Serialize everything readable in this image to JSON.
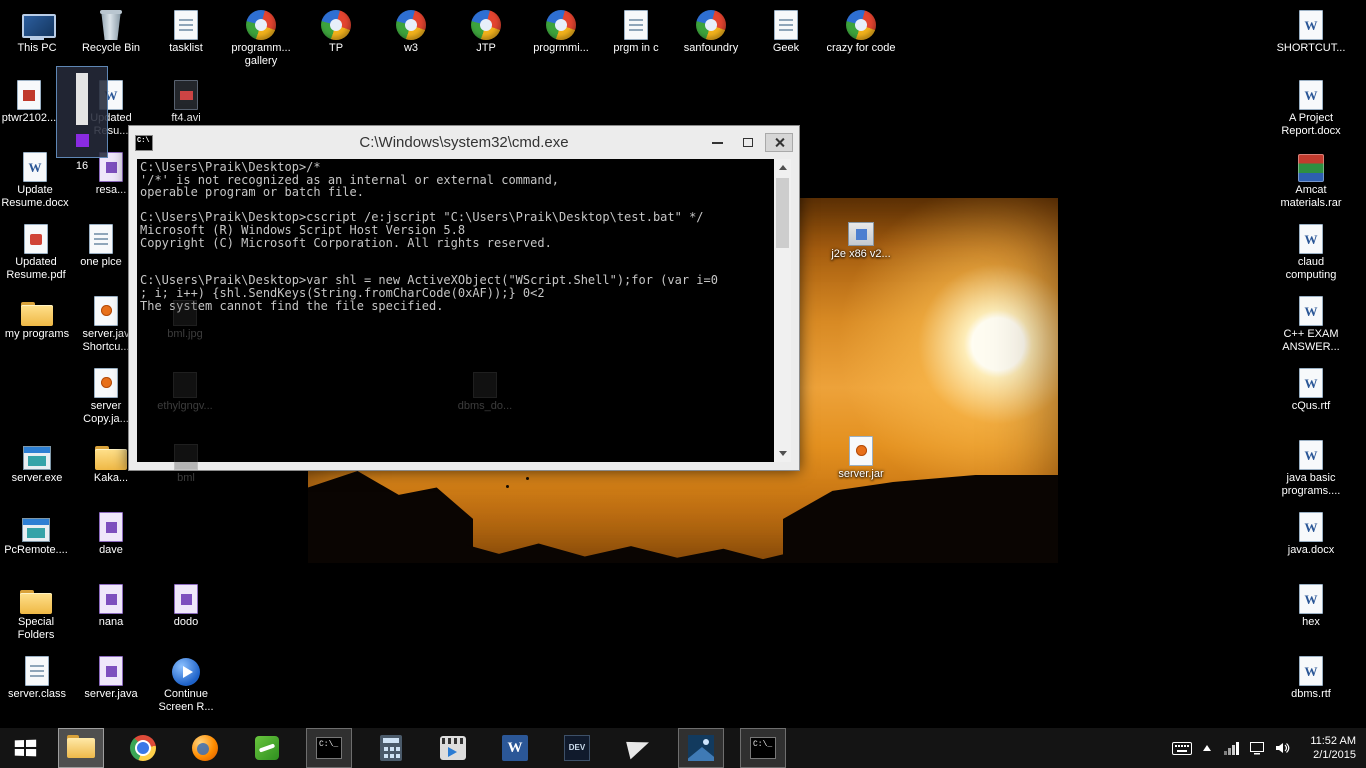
{
  "cmd": {
    "title": "C:\\Windows\\system32\\cmd.exe",
    "lines": [
      "C:\\Users\\Praik\\Desktop>/*",
      "'/*' is not recognized as an internal or external command,",
      "operable program or batch file.",
      "",
      "C:\\Users\\Praik\\Desktop>cscript /e:jscript \"C:\\Users\\Praik\\Desktop\\test.bat\" */",
      "Microsoft (R) Windows Script Host Version 5.8",
      "Copyright (C) Microsoft Corporation. All rights reserved.",
      "",
      "",
      "C:\\Users\\Praik\\Desktop>var shl = new ActiveXObject(\"WScript.Shell\");for (var i=0",
      "; i; i++) {shl.SendKeys(String.fromCharCode(0xAF));} 0<2",
      "The system cannot find the file specified."
    ]
  },
  "desktop": {
    "selected_tile": {
      "label": "16",
      "icon": "slider-icon"
    },
    "icons": [
      {
        "label": "This PC",
        "icon": "computer-icon"
      },
      {
        "label": "Recycle Bin",
        "icon": "recycle-bin-icon"
      },
      {
        "label": "tasklist",
        "icon": "document-icon"
      },
      {
        "label": "programm... gallery",
        "icon": "web-shortcut-icon"
      },
      {
        "label": "TP",
        "icon": "web-shortcut-icon"
      },
      {
        "label": "w3",
        "icon": "web-shortcut-icon"
      },
      {
        "label": "JTP",
        "icon": "web-shortcut-icon"
      },
      {
        "label": "progrmmi...",
        "icon": "web-shortcut-icon"
      },
      {
        "label": "prgm in c",
        "icon": "document-icon"
      },
      {
        "label": "sanfoundry",
        "icon": "web-shortcut-icon"
      },
      {
        "label": "Geek",
        "icon": "document-icon"
      },
      {
        "label": "crazy for code",
        "icon": "web-shortcut-icon"
      },
      {
        "label": "SHORTCUT...",
        "icon": "word-document-icon"
      },
      {
        "label": "ptwr2102...",
        "icon": "red-document-icon"
      },
      {
        "label": "Updated Resu...",
        "icon": "word-document-icon"
      },
      {
        "label": "ft4.avi",
        "icon": "video-file-icon"
      },
      {
        "label": "A Project Report.docx",
        "icon": "word-document-icon"
      },
      {
        "label": "Update Resume.docx",
        "icon": "word-document-icon"
      },
      {
        "label": "resa...",
        "icon": "purple-file-icon"
      },
      {
        "label": "Amcat materials.rar",
        "icon": "rar-archive-icon"
      },
      {
        "label": "Updated Resume.pdf",
        "icon": "pdf-document-icon"
      },
      {
        "label": "one plce",
        "icon": "document-icon"
      },
      {
        "label": "claud computing",
        "icon": "word-document-icon"
      },
      {
        "label": "my programs",
        "icon": "folder-icon"
      },
      {
        "label": "server.jav Shortcu...",
        "icon": "java-file-icon"
      },
      {
        "label": "C++ EXAM ANSWER...",
        "icon": "word-document-icon"
      },
      {
        "label": "server Copy.ja...",
        "icon": "java-file-icon"
      },
      {
        "label": "cQus.rtf",
        "icon": "word-document-icon"
      },
      {
        "label": "server.exe",
        "icon": "application-icon"
      },
      {
        "label": "Kaka...",
        "icon": "folder-icon"
      },
      {
        "label": "java basic programs....",
        "icon": "word-document-icon"
      },
      {
        "label": "PcRemote....",
        "icon": "application-icon"
      },
      {
        "label": "dave",
        "icon": "purple-file-icon"
      },
      {
        "label": "java.docx",
        "icon": "word-document-icon"
      },
      {
        "label": "Special Folders",
        "icon": "folder-icon"
      },
      {
        "label": "nana",
        "icon": "purple-file-icon"
      },
      {
        "label": "dodo",
        "icon": "purple-file-icon"
      },
      {
        "label": "hex",
        "icon": "word-document-icon"
      },
      {
        "label": "server.class",
        "icon": "document-icon"
      },
      {
        "label": "server.java",
        "icon": "purple-file-icon"
      },
      {
        "label": "Continue Screen R...",
        "icon": "blue-app-icon"
      },
      {
        "label": "dbms.rtf",
        "icon": "word-document-icon"
      },
      {
        "label": "j2e x86 v2...",
        "icon": "installer-icon"
      },
      {
        "label": "server.jar",
        "icon": "java-file-icon"
      },
      {
        "label": "bml.jpg",
        "icon": "ghost-file-icon"
      },
      {
        "label": "ethylgngv...",
        "icon": "ghost-file-icon"
      },
      {
        "label": "dbms_do...",
        "icon": "ghost-file-icon"
      },
      {
        "label": "bml",
        "icon": "ghost-file-icon"
      }
    ]
  },
  "taskbar": {
    "items": [
      {
        "icon": "windows-start-icon"
      },
      {
        "icon": "file-explorer-icon"
      },
      {
        "icon": "chrome-icon"
      },
      {
        "icon": "firefox-icon"
      },
      {
        "icon": "green-app-icon"
      },
      {
        "icon": "cmd-icon"
      },
      {
        "icon": "calculator-icon"
      },
      {
        "icon": "movie-maker-icon"
      },
      {
        "icon": "word-icon"
      },
      {
        "icon": "dev-cpp-icon"
      },
      {
        "icon": "mail-icon"
      },
      {
        "icon": "photos-icon"
      },
      {
        "icon": "cmd-icon"
      }
    ],
    "tray": {
      "time": "11:52 AM",
      "date": "2/1/2015"
    }
  }
}
